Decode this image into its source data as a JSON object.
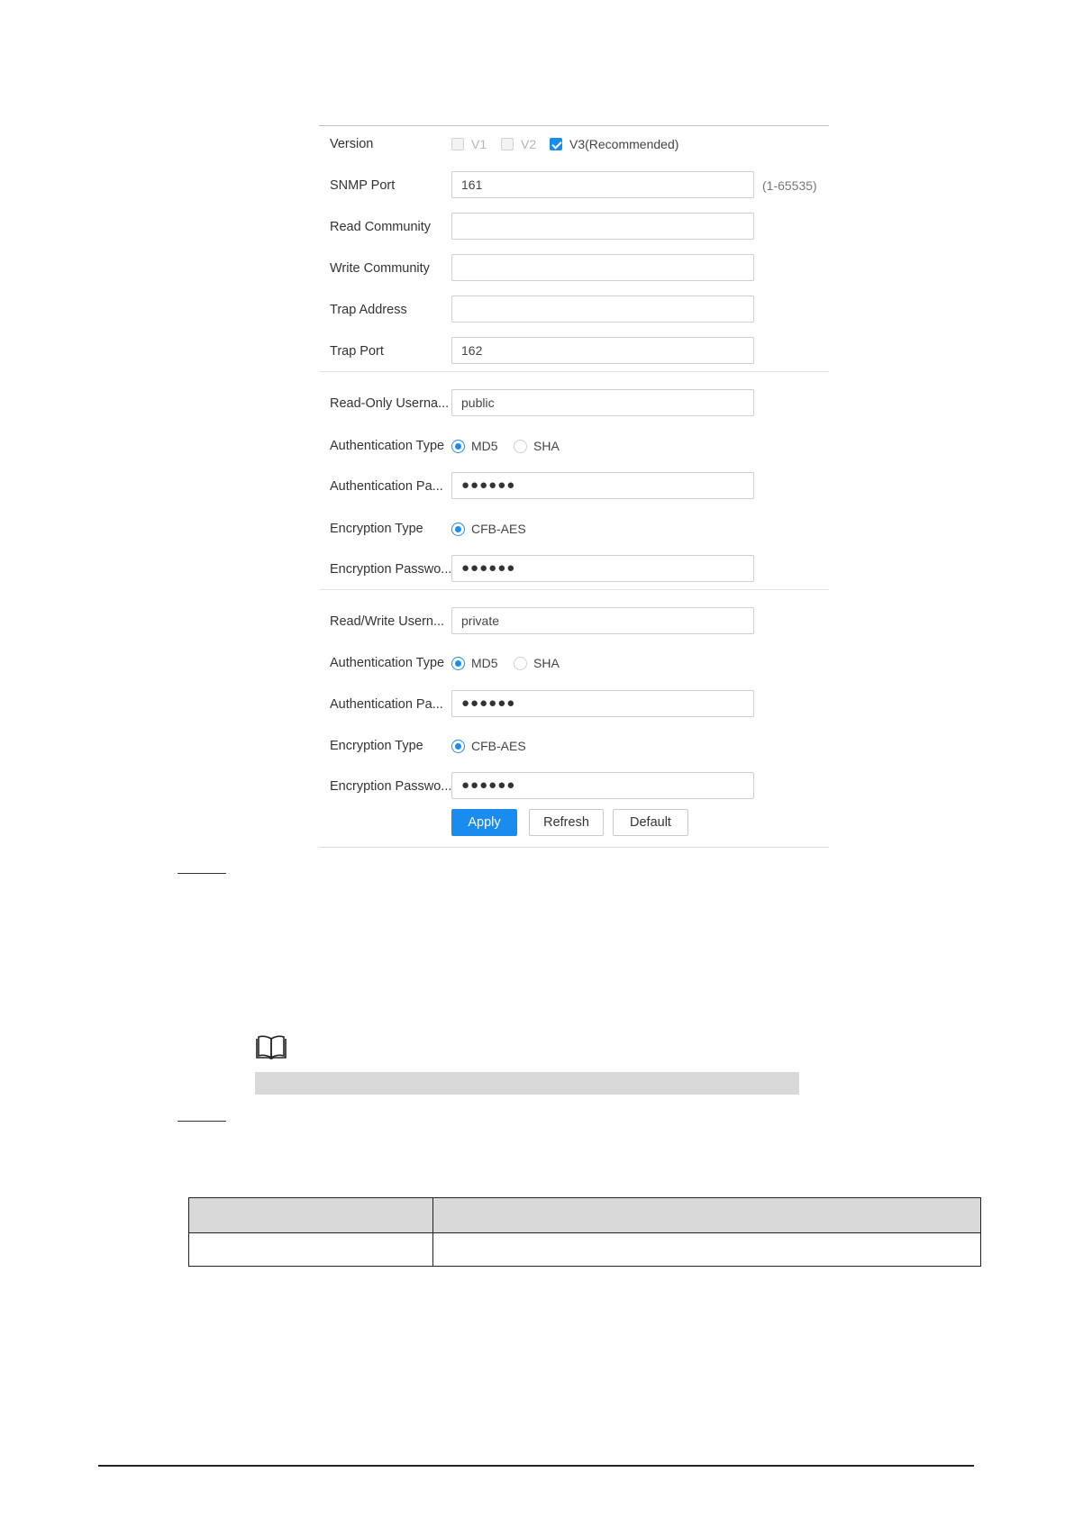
{
  "form": {
    "version": {
      "label": "Version",
      "options": [
        {
          "label": "V1",
          "checked": false,
          "disabled": true
        },
        {
          "label": "V2",
          "checked": false,
          "disabled": true
        },
        {
          "label": "V3(Recommended)",
          "checked": true,
          "disabled": false
        }
      ]
    },
    "snmp_port": {
      "label": "SNMP Port",
      "value": "161",
      "hint": "(1-65535)"
    },
    "read_community": {
      "label": "Read Community",
      "value": ""
    },
    "write_community": {
      "label": "Write Community",
      "value": ""
    },
    "trap_address": {
      "label": "Trap Address",
      "value": ""
    },
    "trap_port": {
      "label": "Trap Port",
      "value": "162"
    },
    "read_only": {
      "username_label": "Read-Only Userna...",
      "username_value": "public",
      "auth_type_label": "Authentication Type",
      "auth_options": [
        {
          "label": "MD5",
          "selected": true
        },
        {
          "label": "SHA",
          "selected": false
        }
      ],
      "auth_password_label": "Authentication Pa...",
      "auth_password_value": "●●●●●●",
      "enc_type_label": "Encryption Type",
      "enc_option": "CFB-AES",
      "enc_password_label": "Encryption Passwo...",
      "enc_password_value": "●●●●●●"
    },
    "read_write": {
      "username_label": "Read/Write Usern...",
      "username_value": "private",
      "auth_type_label": "Authentication Type",
      "auth_options": [
        {
          "label": "MD5",
          "selected": true
        },
        {
          "label": "SHA",
          "selected": false
        }
      ],
      "auth_password_label": "Authentication Pa...",
      "auth_password_value": "●●●●●●",
      "enc_type_label": "Encryption Type",
      "enc_option": "CFB-AES",
      "enc_password_label": "Encryption Passwo...",
      "enc_password_value": "●●●●●●"
    },
    "buttons": {
      "apply": "Apply",
      "refresh": "Refresh",
      "default": "Default"
    }
  },
  "colors": {
    "accent": "#1a8cf0",
    "note_bar": "#d9d9d9",
    "table_header": "#d9d9d9"
  },
  "icons": {
    "note": "book-icon"
  }
}
